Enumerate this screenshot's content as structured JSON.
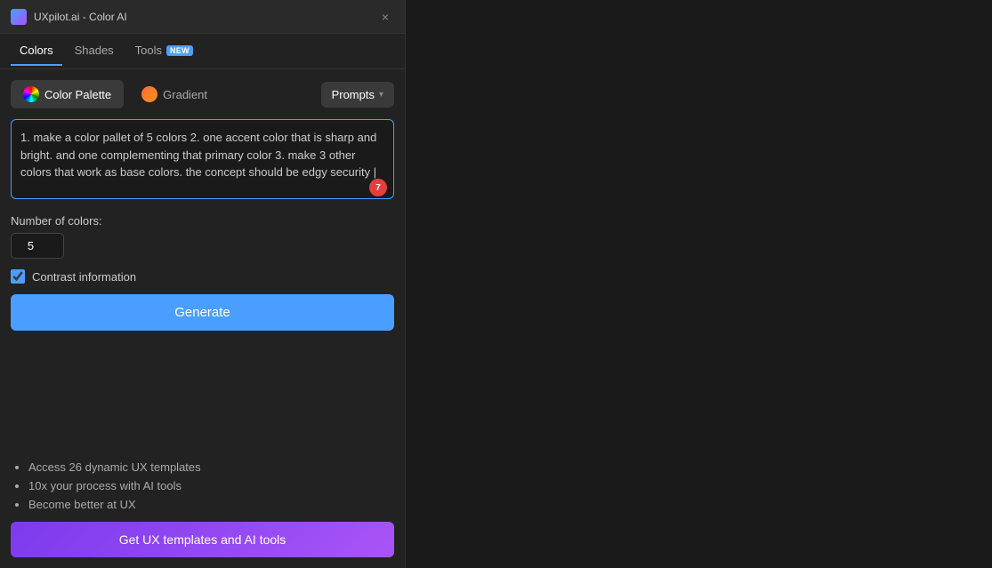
{
  "titleBar": {
    "appName": "UXpilot.ai - Color AI",
    "closeLabel": "×"
  },
  "navTabs": [
    {
      "id": "colors",
      "label": "Colors",
      "active": true,
      "badge": null
    },
    {
      "id": "shades",
      "label": "Shades",
      "active": false,
      "badge": null
    },
    {
      "id": "tools",
      "label": "Tools",
      "active": false,
      "badge": "NEW"
    }
  ],
  "modeButtons": [
    {
      "id": "color-palette",
      "label": "Color Palette",
      "active": true
    },
    {
      "id": "gradient",
      "label": "Gradient",
      "active": false
    }
  ],
  "promptsDropdown": {
    "label": "Prompts"
  },
  "promptTextarea": {
    "value": "1. make a color pallet of 5 colors 2. one accent color that is sharp and bright. and one complementing that primary color 3. make 3 other colors that work as base colors. the concept should be edgy security |",
    "charBadge": "7"
  },
  "numberOfColors": {
    "label": "Number of colors:",
    "value": "5"
  },
  "contrastInfo": {
    "label": "Contrast information",
    "checked": true
  },
  "generateButton": {
    "label": "Generate"
  },
  "featuresList": [
    "Access 26 dynamic UX templates",
    "10x your process with AI tools",
    "Become better at UX"
  ],
  "upgradeButton": {
    "label": "Get UX templates and AI tools"
  }
}
